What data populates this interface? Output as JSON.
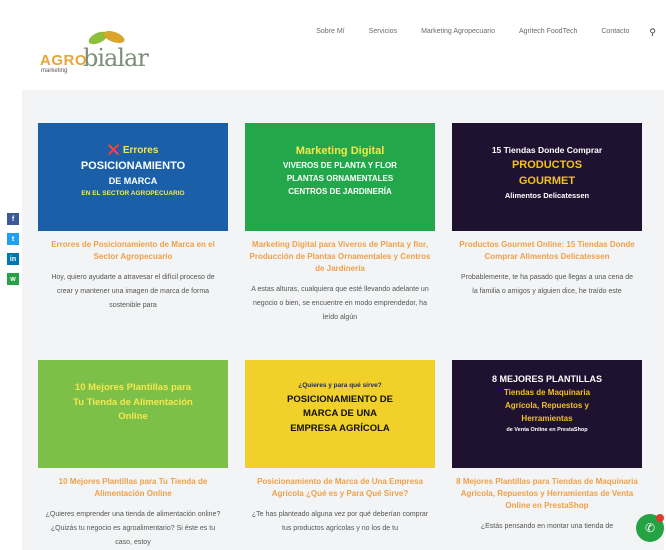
{
  "logo": {
    "part1": "AGRO",
    "part2": "bialar",
    "tagline": "marketing"
  },
  "nav": {
    "items": [
      "Sobre Mí",
      "Servicios",
      "Marketing Agropecuario",
      "Agritech FoodTech",
      "Contacto"
    ],
    "search_icon": "search-icon"
  },
  "share": [
    {
      "name": "facebook-icon",
      "glyph": "f",
      "color": "#3b5998"
    },
    {
      "name": "twitter-icon",
      "glyph": "t",
      "color": "#1da1f2"
    },
    {
      "name": "linkedin-icon",
      "glyph": "in",
      "color": "#0077b5"
    },
    {
      "name": "whatsapp-icon",
      "glyph": "w",
      "color": "#25a244"
    }
  ],
  "cards": [
    {
      "thumb_lines": [
        "❌ Errores",
        "POSICIONAMIENTO",
        "DE MARCA",
        "EN EL SECTOR AGROPECUARIO"
      ],
      "thumb_bg": "#1a5fa8",
      "title": "Errores de Posicionamiento de Marca en el Sector Agropecuario",
      "excerpt": "Hoy, quiero ayudarte a atravesar el difícil proceso de crear y mantener una imagen de marca de forma sostenible para"
    },
    {
      "thumb_lines": [
        "Marketing Digital",
        "VIVEROS DE PLANTA Y FLOR",
        "PLANTAS ORNAMENTALES",
        "CENTROS DE JARDINERÍA"
      ],
      "thumb_bg": "#22a84a",
      "title": "Marketing Digital para Viveros de Planta y flor, Producción de Plantas Ornamentales y Centros de Jardinería",
      "excerpt": "A estas alturas, cualquiera que esté llevando adelante un negocio o bien, se encuentre en modo emprendedor, ha leído algún"
    },
    {
      "thumb_lines": [
        "15 Tiendas Donde Comprar",
        "PRODUCTOS",
        "GOURMET",
        "Alimentos Delicatessen"
      ],
      "thumb_bg": "#1e1230",
      "title": "Productos Gourmet Online: 15 Tiendas Donde Comprar Alimentos Delicatessen",
      "excerpt": "Probablemente, te ha pasado que llegas a una cena de la familia o amigos y alguien dice, he traído este"
    },
    {
      "thumb_lines": [
        "10 Mejores Plantillas para",
        "Tu Tienda de Alimentación",
        "Online"
      ],
      "thumb_bg": "#7cc04a",
      "title": "10 Mejores Plantillas para Tu Tienda de Alimentación Online",
      "excerpt": "¿Quieres emprender una tienda de alimentación online? ¿Quizás tu negocio es agroalimentario? Si éste es tu caso, estoy"
    },
    {
      "thumb_lines": [
        "¿Quieres y para qué sirve?",
        "POSICIONAMIENTO DE",
        "MARCA DE UNA",
        "EMPRESA AGRÍCOLA"
      ],
      "thumb_bg": "#f2d02a",
      "title": "Posicionamiento de Marca de Una Empresa Agrícola ¿Qué es y Para Qué Sirve?",
      "excerpt": "¿Te has planteado alguna vez por qué deberían comprar tus productos agrícolas y no los de tu"
    },
    {
      "thumb_lines": [
        "8 MEJORES PLANTILLAS",
        "Tiendas de Maquinaria",
        "Agrícola, Repuestos y",
        "Herramientas",
        "de Venta Online en PrestaShop"
      ],
      "thumb_bg": "#1e1230",
      "title": "8 Mejores Plantillas para Tiendas de Maquinaria Agrícola, Repuestos y Herramientas de Venta Online en PrestaShop",
      "excerpt": "¿Estás pensando en montar una tienda de"
    }
  ],
  "whatsapp": {
    "icon": "whatsapp-icon",
    "glyph": "✆"
  }
}
